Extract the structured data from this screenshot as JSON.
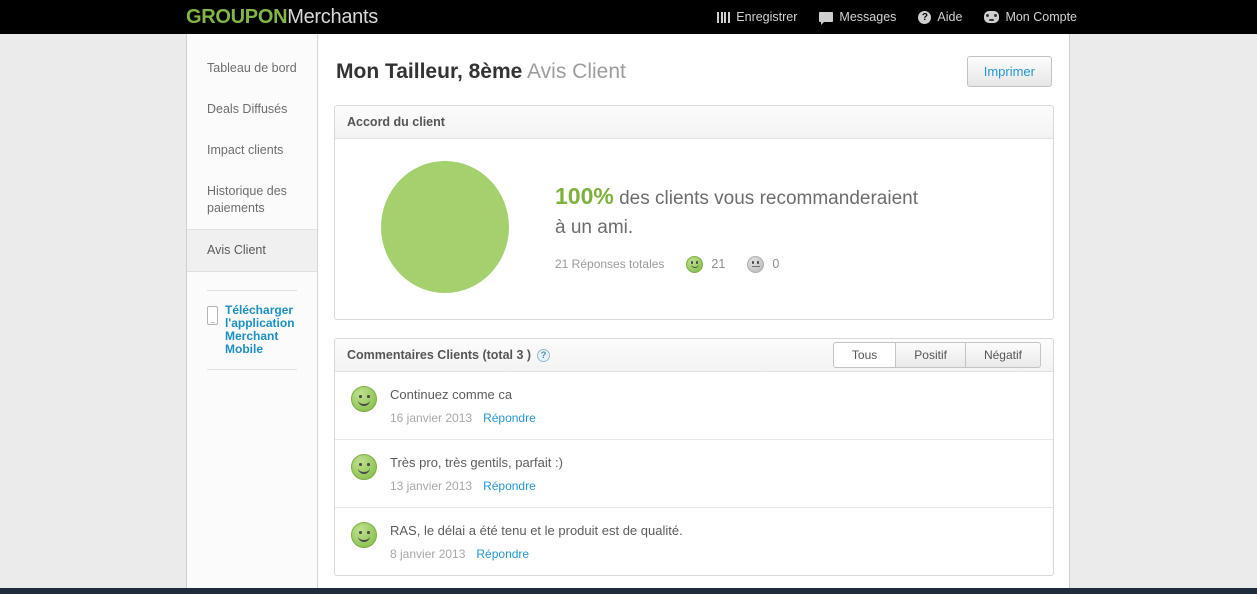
{
  "topbar": {
    "brand_primary": "GROUPON",
    "brand_secondary": "Merchants",
    "brand_color": "#82b548",
    "nav": [
      {
        "label": "Enregistrer",
        "icon": "bars-icon"
      },
      {
        "label": "Messages",
        "icon": "chat-icon"
      },
      {
        "label": "Aide",
        "icon": "help-circle-icon",
        "glyph": "?"
      },
      {
        "label": "Mon Compte",
        "icon": "account-face-icon"
      }
    ]
  },
  "sidebar": {
    "items": [
      {
        "label": "Tableau de bord",
        "active": false
      },
      {
        "label": "Deals Diffusés",
        "active": false
      },
      {
        "label": "Impact clients",
        "active": false
      },
      {
        "label": "Historique des paiements",
        "active": false
      },
      {
        "label": "Avis Client",
        "active": true
      }
    ],
    "app_link": {
      "label": "Télécharger l'application Merchant Mobile",
      "color": "#1b8fc4",
      "icon": "mobile-phone-icon"
    }
  },
  "page": {
    "title_strong": "Mon Tailleur, 8ème",
    "title_light": "Avis Client",
    "print_button": "Imprimer"
  },
  "agreement_panel": {
    "header": "Accord du client",
    "percent": "100%",
    "statement_line1": "des clients vous recommanderaient",
    "statement_line2": "à un ami.",
    "total_responses": "21 Réponses totales",
    "positive_count": "21",
    "neutral_count": "0",
    "pie_color": "#a4d06e",
    "percent_color": "#7eb03c"
  },
  "comments_panel": {
    "header": "Commentaires Clients (total 3 )",
    "help_glyph": "?",
    "filters": [
      {
        "label": "Tous",
        "active": true
      },
      {
        "label": "Positif",
        "active": false
      },
      {
        "label": "Négatif",
        "active": false
      }
    ],
    "items": [
      {
        "text": "Continuez comme ca",
        "date": "16 janvier 2013",
        "reply": "Répondre",
        "sentiment": "positive"
      },
      {
        "text": "Très pro, très gentils, parfait :)",
        "date": "13 janvier 2013",
        "reply": "Répondre",
        "sentiment": "positive"
      },
      {
        "text": "RAS, le délai a été tenu et le produit est de qualité.",
        "date": "8 janvier 2013",
        "reply": "Répondre",
        "sentiment": "positive"
      }
    ]
  }
}
